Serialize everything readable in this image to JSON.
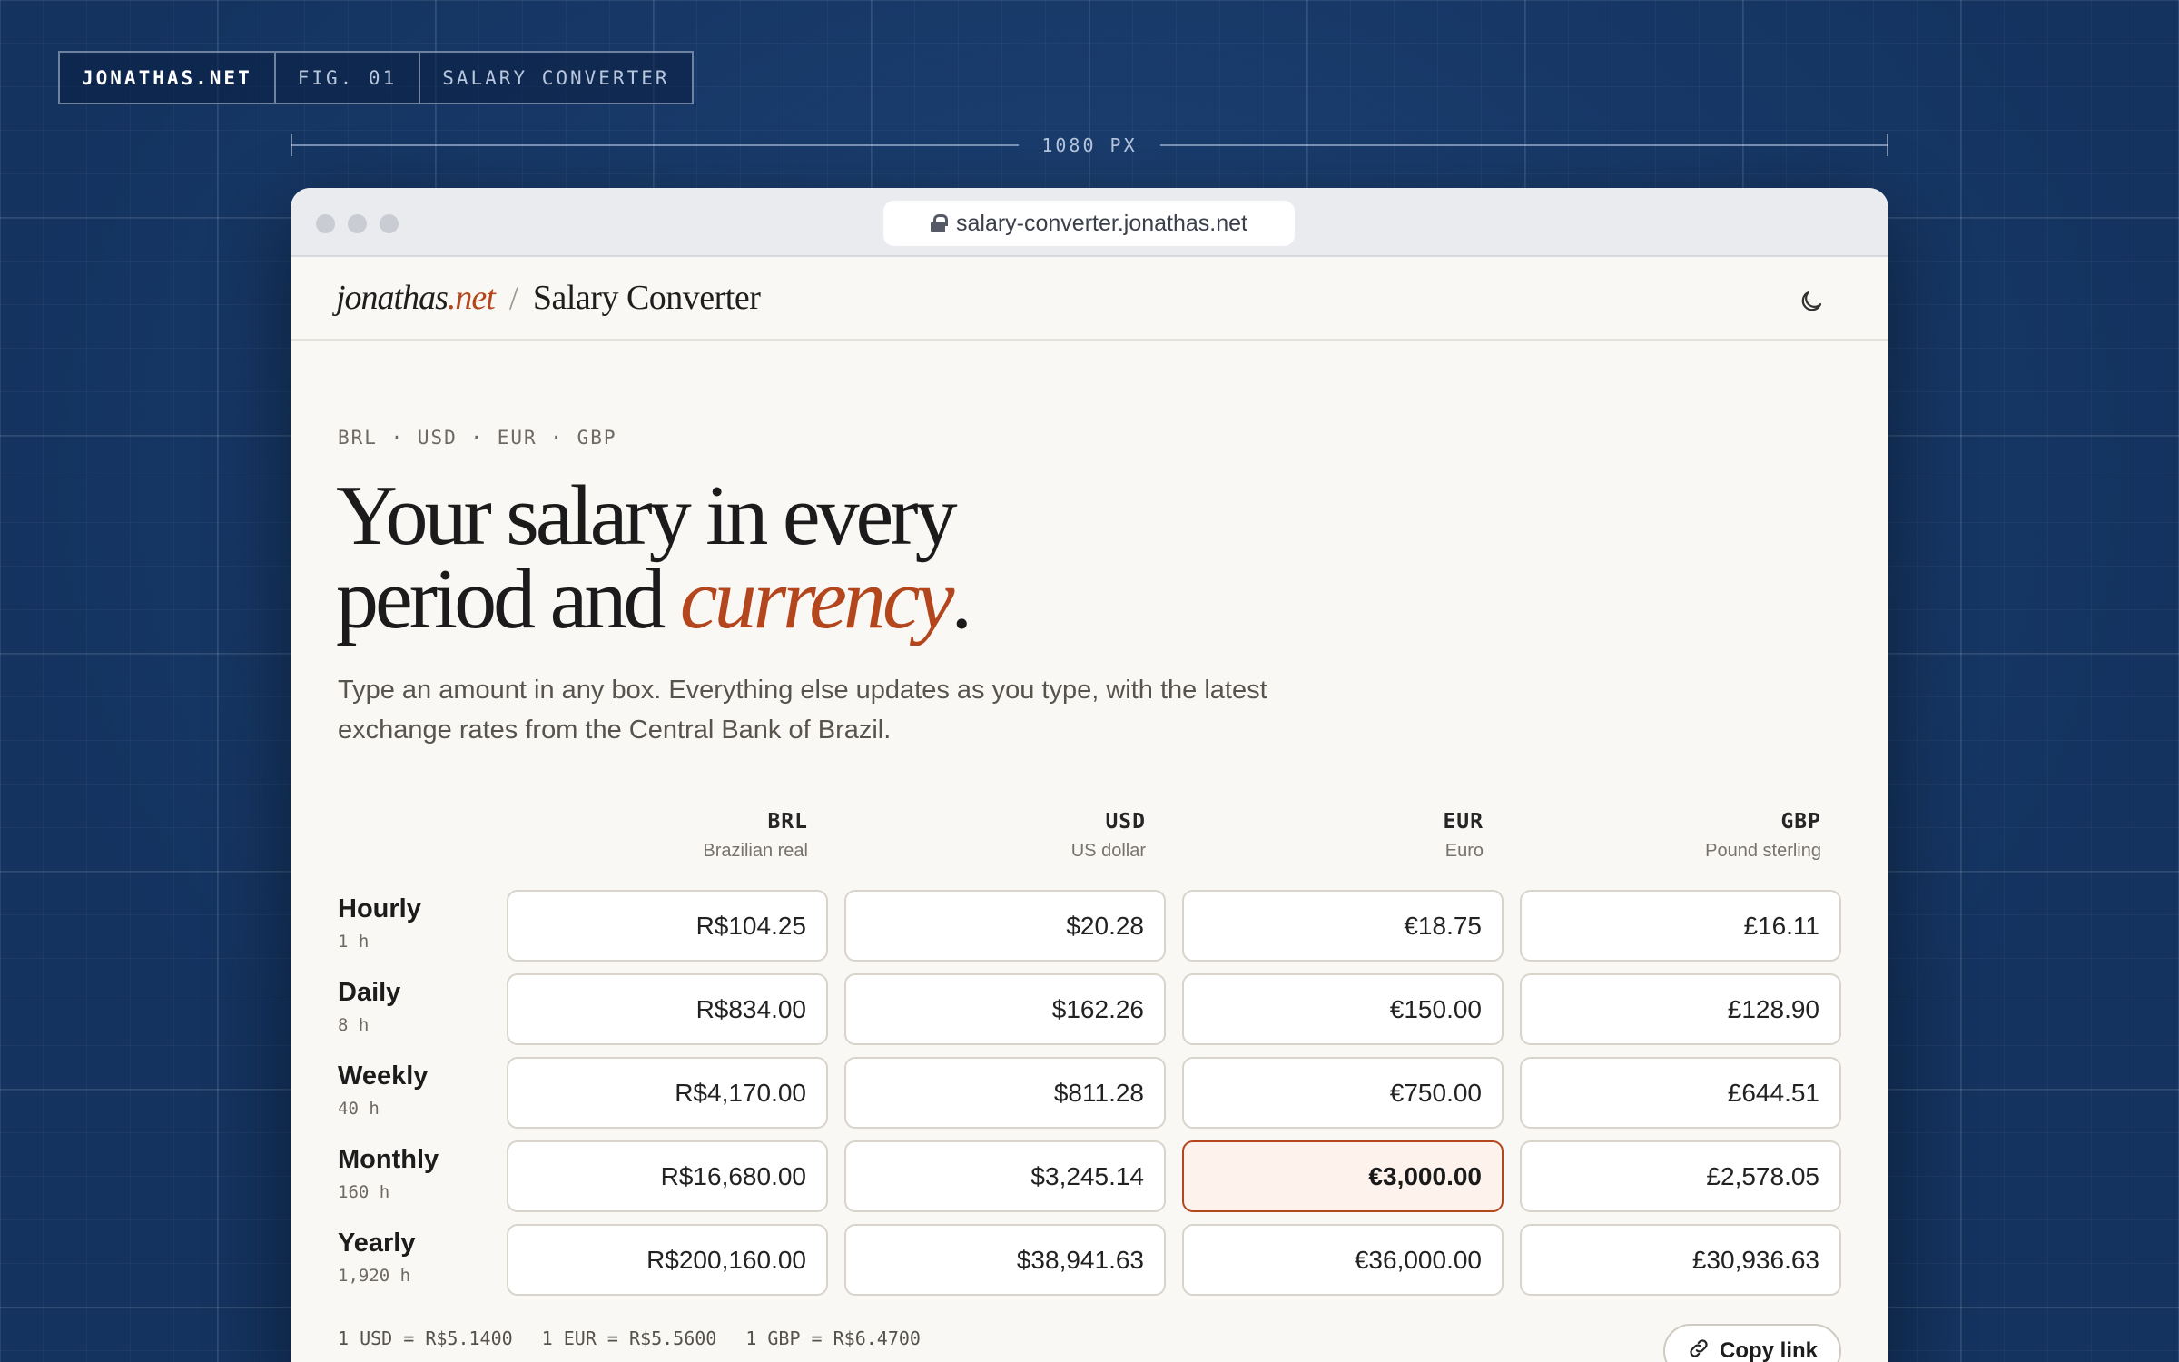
{
  "figure_chip": {
    "site": "JONATHAS.NET",
    "figure": "FIG. 01",
    "subject": "SALARY CONVERTER"
  },
  "dimension_label": "1080 PX",
  "browser": {
    "url": "salary-converter.jonathas.net"
  },
  "header": {
    "brand_name": "jonathas",
    "brand_tld": ".net",
    "separator": "/",
    "page_title": "Salary Converter",
    "theme_icon": "moon-icon"
  },
  "hero": {
    "eyebrow": "BRL · USD · EUR · GBP",
    "headline_line1": "Your salary in every",
    "headline_line2_start": "period and ",
    "headline_emphasis": "currency",
    "headline_end": ".",
    "lede": "Type an amount in any box. Everything else updates as you type, with the latest exchange rates from the Central Bank of Brazil."
  },
  "table": {
    "columns": [
      {
        "code": "BRL",
        "name": "Brazilian real"
      },
      {
        "code": "USD",
        "name": "US dollar"
      },
      {
        "code": "EUR",
        "name": "Euro"
      },
      {
        "code": "GBP",
        "name": "Pound sterling"
      }
    ],
    "rows": [
      {
        "label": "Hourly",
        "hours": "1 h",
        "values": [
          "R$104.25",
          "$20.28",
          "€18.75",
          "£16.11"
        ]
      },
      {
        "label": "Daily",
        "hours": "8 h",
        "values": [
          "R$834.00",
          "$162.26",
          "€150.00",
          "£128.90"
        ]
      },
      {
        "label": "Weekly",
        "hours": "40 h",
        "values": [
          "R$4,170.00",
          "$811.28",
          "€750.00",
          "£644.51"
        ]
      },
      {
        "label": "Monthly",
        "hours": "160 h",
        "values": [
          "R$16,680.00",
          "$3,245.14",
          "€3,000.00",
          "£2,578.05"
        ]
      },
      {
        "label": "Yearly",
        "hours": "1,920 h",
        "values": [
          "R$200,160.00",
          "$38,941.63",
          "€36,000.00",
          "£30,936.63"
        ]
      }
    ],
    "active_cell": {
      "row": "Monthly",
      "column": "EUR"
    }
  },
  "rates": [
    "1 USD = R$5.1400",
    "1 EUR = R$5.5600",
    "1 GBP = R$6.4700"
  ],
  "copy_link": {
    "label": "Copy link",
    "icon": "link-icon"
  },
  "colors": {
    "accent": "#b4461e",
    "background": "#173a68",
    "page": "#faf8f4"
  }
}
